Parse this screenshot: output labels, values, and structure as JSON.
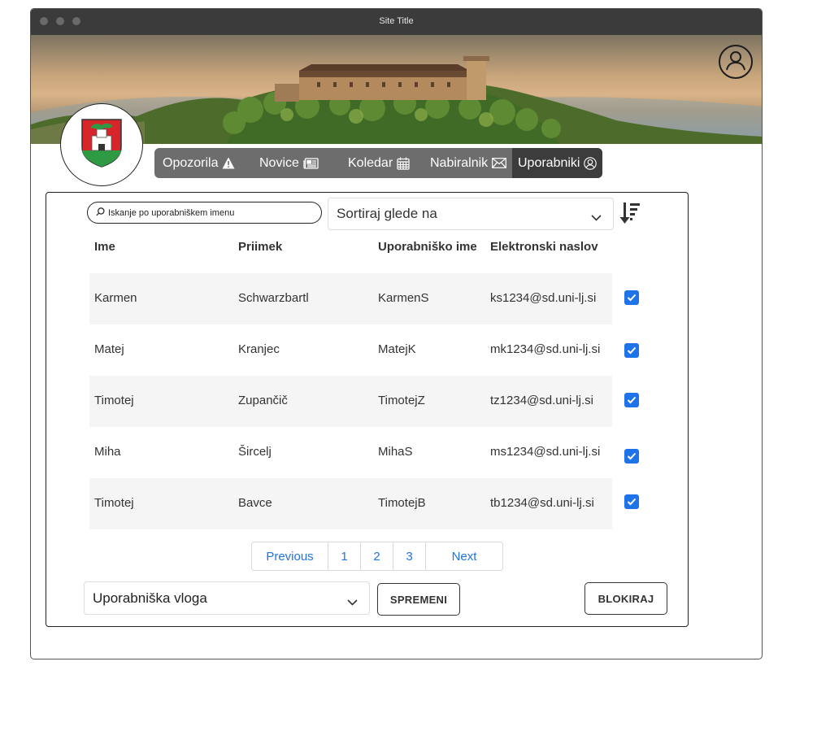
{
  "window": {
    "title": "Site Title"
  },
  "header": {
    "profile_icon": "user-circle-icon",
    "crest_icon": "city-crest-dragon-icon"
  },
  "nav": {
    "items": [
      {
        "label": "Opozorila",
        "icon": "warning-triangle-icon"
      },
      {
        "label": "Novice",
        "icon": "newspaper-icon"
      },
      {
        "label": "Koledar",
        "icon": "calendar-icon"
      },
      {
        "label": "Nabiralnik",
        "icon": "envelope-icon"
      },
      {
        "label": "Uporabniki",
        "icon": "user-circle-icon",
        "active": true
      }
    ]
  },
  "search": {
    "placeholder": "Iskanje po uporabniškem imenu",
    "value": ""
  },
  "sort": {
    "label": "Sortiraj glede na",
    "icon": "sort-descending-icon"
  },
  "table": {
    "columns": [
      "Ime",
      "Priimek",
      "Uporabniško ime",
      "Elektronski naslov"
    ],
    "rows": [
      {
        "ime": "Karmen",
        "priimek": "Schwarzbartl",
        "username": "KarmenS",
        "email": "ks1234@sd.uni-lj.si",
        "checked": true
      },
      {
        "ime": "Matej",
        "priimek": "Kranjec",
        "username": "MatejK",
        "email": "mk1234@sd.uni-lj.si",
        "checked": true
      },
      {
        "ime": "Timotej",
        "priimek": "Zupančič",
        "username": "TimotejZ",
        "email": "tz1234@sd.uni-lj.si",
        "checked": true
      },
      {
        "ime": "Miha",
        "priimek": "Šircelj",
        "username": "MihaS",
        "email": "ms1234@sd.uni-lj.si",
        "checked": true
      },
      {
        "ime": "Timotej",
        "priimek": "Bavce",
        "username": "TimotejB",
        "email": "tb1234@sd.uni-lj.si",
        "checked": true
      }
    ]
  },
  "pagination": {
    "previous": "Previous",
    "pages": [
      "1",
      "2",
      "3"
    ],
    "next": "Next"
  },
  "footer": {
    "role_select": "Uporabniška vloga",
    "change_button": "SPREMENI",
    "block_button": "BLOKIRAJ"
  },
  "colors": {
    "accent": "#1f73e8",
    "nav_bg": "#6d6d6d",
    "nav_active": "#3c3c3c",
    "titlebar": "#3b3b3b"
  }
}
